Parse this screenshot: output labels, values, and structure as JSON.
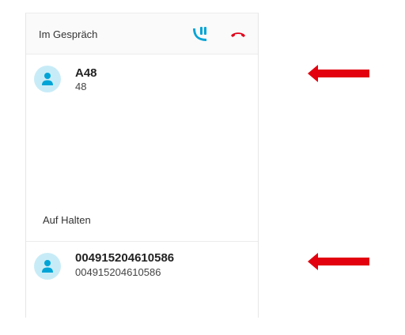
{
  "header": {
    "title": "Im Gespräch",
    "merge_icon": "call-merge-icon",
    "hangup_icon": "hangup-icon"
  },
  "active_call": {
    "name": "A48",
    "number": "48",
    "avatar_icon": "person-icon"
  },
  "held_section": {
    "label": "Auf Halten"
  },
  "held_call": {
    "name": "004915204610586",
    "number": "004915204610586",
    "avatar_icon": "person-icon"
  },
  "colors": {
    "accent": "#00a4d6",
    "avatar_bg": "#c8ecf7",
    "hangup": "#e2001a",
    "annotation_arrow": "#e3000f"
  }
}
